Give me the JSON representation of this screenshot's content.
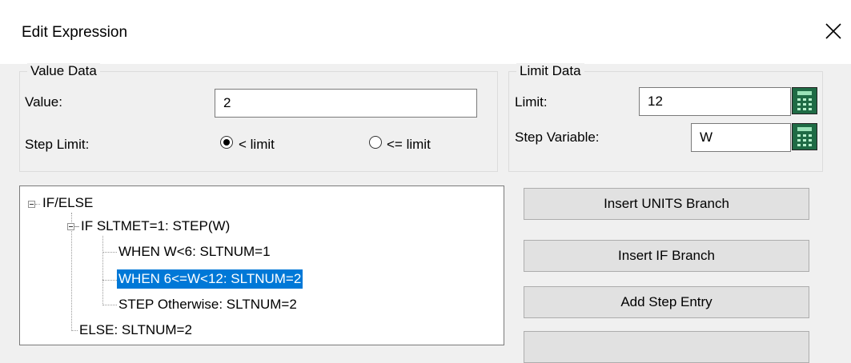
{
  "window": {
    "title": "Edit Expression",
    "close_icon": "close-icon"
  },
  "value_data": {
    "legend": "Value Data",
    "value_label": "Value:",
    "value": "2",
    "step_limit_label": "Step Limit:",
    "options": [
      {
        "label": "< limit",
        "selected": true
      },
      {
        "label": "<= limit",
        "selected": false
      }
    ]
  },
  "limit_data": {
    "legend": "Limit Data",
    "limit_label": "Limit:",
    "limit_value": "12",
    "step_variable_label": "Step Variable:",
    "step_variable_value": "W",
    "calculator_icon": "calculator-icon"
  },
  "tree": {
    "nodes": [
      {
        "label": "IF/ELSE",
        "expanded": true
      },
      {
        "label": "IF SLTMET=1: STEP(W)",
        "expanded": true
      },
      {
        "label": "WHEN W<6: SLTNUM=1"
      },
      {
        "label": "WHEN 6<=W<12: SLTNUM=2",
        "selected": true
      },
      {
        "label": "STEP Otherwise: SLTNUM=2"
      },
      {
        "label": "ELSE: SLTNUM=2"
      }
    ]
  },
  "buttons": {
    "insert_units_branch": "Insert UNITS Branch",
    "insert_if_branch": "Insert IF Branch",
    "add_step_entry": "Add Step Entry",
    "fourth": ""
  },
  "colors": {
    "selection": "#0078d7",
    "calculator": "#1f6b45",
    "dialog_bg": "#f0f0f0"
  }
}
